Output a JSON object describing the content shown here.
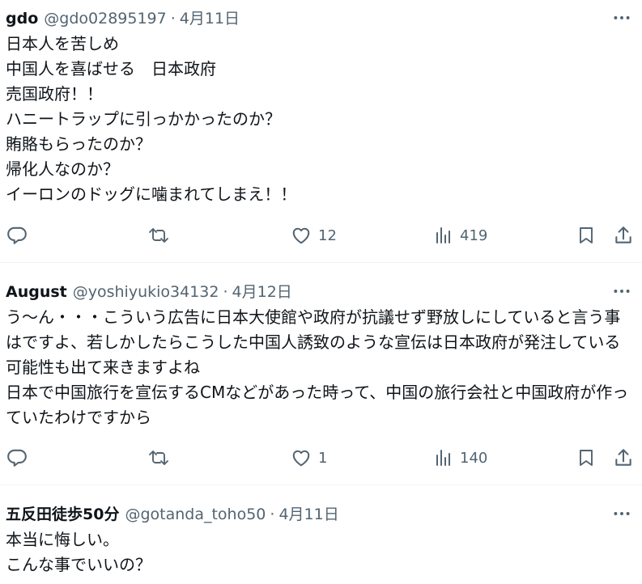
{
  "tweets": [
    {
      "name": "gdo",
      "handle": "@gdo02895197",
      "separator": "·",
      "date": "4月11日",
      "lines": [
        "日本人を苦しめ",
        "中国人を喜ばせる　日本政府",
        "売国政府！！",
        "ハニートラップに引っかかったのか？",
        "賄賂もらったのか？",
        "帰化人なのか？",
        "イーロンのドッグに噛まれてしまえ！！"
      ],
      "likes": "12",
      "views": "419"
    },
    {
      "name": "August",
      "handle": "@yoshiyukio34132",
      "separator": "·",
      "date": "4月12日",
      "lines": [
        "う～ん・・・こういう広告に日本大使館や政府が抗議せず野放しにしていると言う事はですよ、若しかしたらこうした中国人誘致のような宣伝は日本政府が発注している可能性も出て来きますよね",
        "日本で中国旅行を宣伝するCMなどがあった時って、中国の旅行会社と中国政府が作っていたわけですから"
      ],
      "likes": "1",
      "views": "140"
    },
    {
      "name": "五反田徒歩50分",
      "handle": "@gotanda_toho50",
      "separator": "·",
      "date": "4月11日",
      "lines": [
        "本当に悔しい。",
        "こんな事でいいの？"
      ]
    }
  ],
  "icons": {
    "more": "more-dots-icon",
    "reply": "reply-icon",
    "retweet": "retweet-icon",
    "like": "heart-icon",
    "views": "views-icon",
    "bookmark": "bookmark-icon",
    "share": "share-icon"
  },
  "colors": {
    "text": "#0f1419",
    "secondary": "#536471",
    "divider": "#eff3f4"
  }
}
